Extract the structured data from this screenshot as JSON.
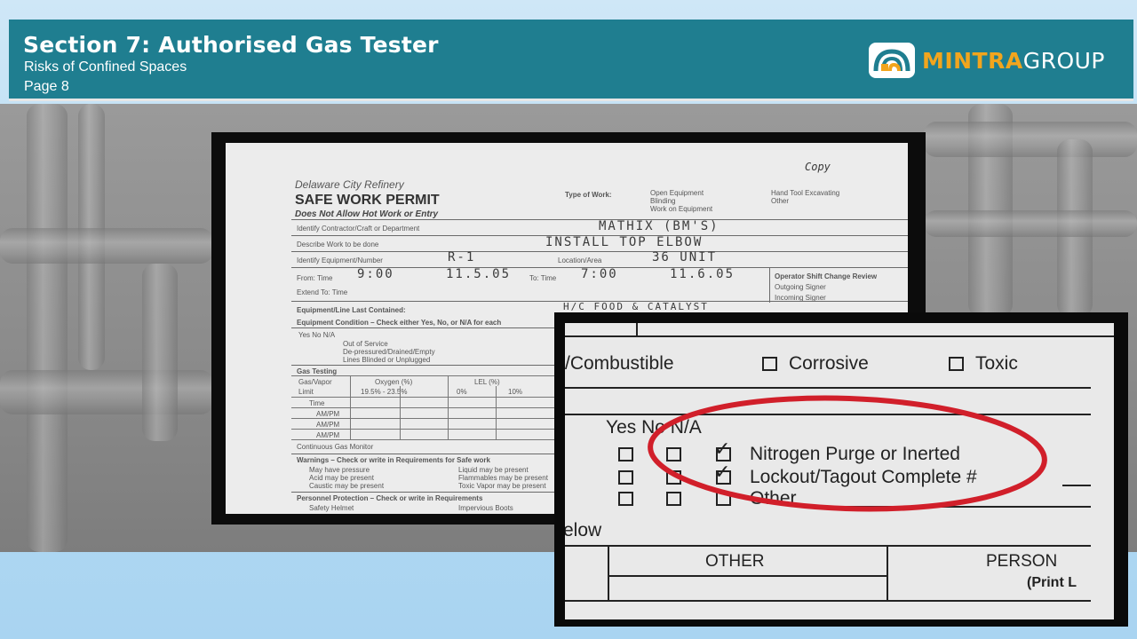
{
  "header": {
    "title": "Section 7: Authorised Gas Tester",
    "subtitle": "Risks of Confined Spaces",
    "page": "Page 8"
  },
  "logo": {
    "icon": "mintra-logo-icon",
    "brand_part1": "MINTRA",
    "brand_part2": "GROUP"
  },
  "permit": {
    "copy_note": "Copy",
    "company": "Delaware City Refinery",
    "title": "SAFE WORK PERMIT",
    "subtitle": "Does Not Allow Hot Work or Entry",
    "type_of_work_label": "Type of Work:",
    "type_options": [
      "Open Equipment",
      "Blinding",
      "Work on Equipment",
      "Hand Tool Excavating",
      "Other"
    ],
    "rows": [
      {
        "label": "Identify Contractor/Craft or Department",
        "value": "MATHIX (BM'S)"
      },
      {
        "label": "Describe Work to be done",
        "value": "INSTALL TOP ELBOW"
      },
      {
        "label": "Identify Equipment/Number",
        "value": "R-1"
      },
      {
        "label": "Location/Area",
        "value": "36 UNIT"
      }
    ],
    "from_label": "From: Time",
    "from_time": "9:00",
    "from_date": "11.5.05",
    "to_label": "To: Time",
    "to_time": "7:00",
    "to_date": "11.6.05",
    "extend_label": "Extend To: Time",
    "operator_shift": "Operator Shift Change Review",
    "outgoing": "Outgoing Signer",
    "incoming": "Incoming Signer",
    "equipment_last_contained": "Equipment/Line Last Contained:",
    "contained_value": "H/C FOOD & CATALYST",
    "equipment_condition": "Equipment Condition – Check either Yes, No, or N/A for each",
    "yes_no_na": "Yes  No  N/A",
    "conditions": [
      "Out of Service",
      "De-pressured/Drained/Empty",
      "Lines Blinded or Unplugged"
    ],
    "gas_testing": "Gas Testing",
    "gas_headers": [
      "Gas/Vapor",
      "Oxygen (%)",
      "LEL (%)"
    ],
    "gas_limits": [
      "Limit",
      "19.5% - 23.5%",
      "0%",
      "10%"
    ],
    "gas_rows": [
      "Time",
      "AM/PM",
      "AM/PM",
      "AM/PM"
    ],
    "continuous_monitor": "Continuous Gas Monitor",
    "warnings": "Warnings – Check or write in Requirements for Safe work",
    "warning_items": [
      "May have pressure",
      "Acid may be present",
      "Caustic may be present",
      "Liquid may be present",
      "Flammables may be present",
      "Toxic Vapor may be present"
    ],
    "ppe": "Personnel Protection – Check or write in Requirements",
    "ppe_items": [
      "Safety Helmet",
      "Impervious Boots"
    ]
  },
  "zoom": {
    "combustible": "/Combustible",
    "corrosive": "Corrosive",
    "toxic": "Toxic",
    "yes_no_na": "Yes No N/A",
    "items": [
      "Nitrogen Purge or Inerted",
      "Lockout/Tagout Complete #",
      "Other"
    ],
    "below": "elow",
    "other_header": "OTHER",
    "person_header": "PERSON",
    "print_label": "(Print L",
    "highlight_color": "#d11f2a"
  }
}
